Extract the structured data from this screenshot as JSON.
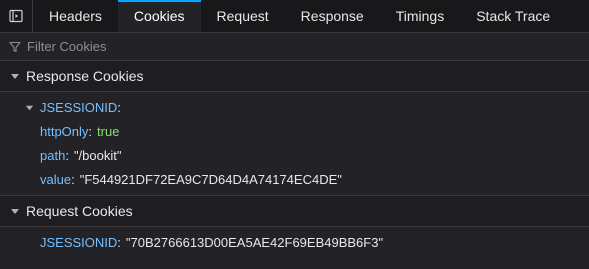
{
  "tabs": [
    {
      "label": "Headers",
      "active": false
    },
    {
      "label": "Cookies",
      "active": true
    },
    {
      "label": "Request",
      "active": false
    },
    {
      "label": "Response",
      "active": false
    },
    {
      "label": "Timings",
      "active": false
    },
    {
      "label": "Stack Trace",
      "active": false
    }
  ],
  "filter": {
    "placeholder": "Filter Cookies",
    "value": ""
  },
  "response_cookies": {
    "title": "Response Cookies",
    "cookie_name": "JSESSIONID",
    "props": [
      {
        "key": "httpOnly",
        "value": "true",
        "type": "bool"
      },
      {
        "key": "path",
        "value": "\"/bookit\"",
        "type": "string"
      },
      {
        "key": "value",
        "value": "\"F544921DF72EA9C7D64D4A74174EC4DE\"",
        "type": "string"
      }
    ]
  },
  "request_cookies": {
    "title": "Request Cookies",
    "cookie_key": "JSESSIONID",
    "cookie_value": "\"70B2766613D00EA5AE42F69EB49BB6F3\""
  },
  "colors": {
    "accent": "#00a8ff",
    "key": "#75bfff",
    "bool": "#86de74",
    "background": "#232327"
  },
  "icons": [
    "panel-toggle-icon",
    "filter-icon",
    "chevron-down-icon"
  ]
}
